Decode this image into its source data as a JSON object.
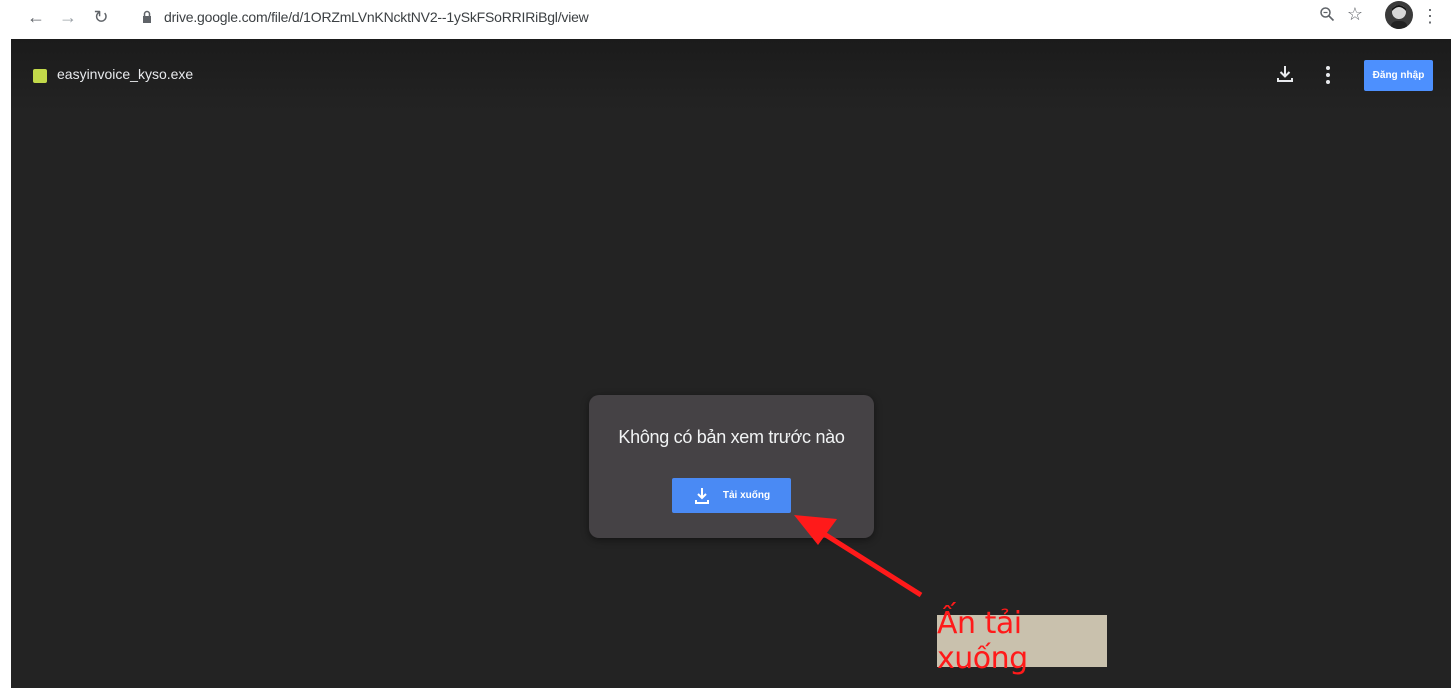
{
  "browser": {
    "url": "drive.google.com/file/d/1ORZmLVnKNcktNV2--1ySkFSoRRIRiBgl/view"
  },
  "viewer": {
    "file_name": "easyinvoice_kyso.exe",
    "signin_label": "Đăng nhập",
    "file_icon_color": "#c2d94a"
  },
  "preview": {
    "message": "Không có bản xem trước nào",
    "download_label": "Tải xuống"
  },
  "annotation": {
    "text": "Ấn tải xuống",
    "color": "#ff1a1a"
  }
}
